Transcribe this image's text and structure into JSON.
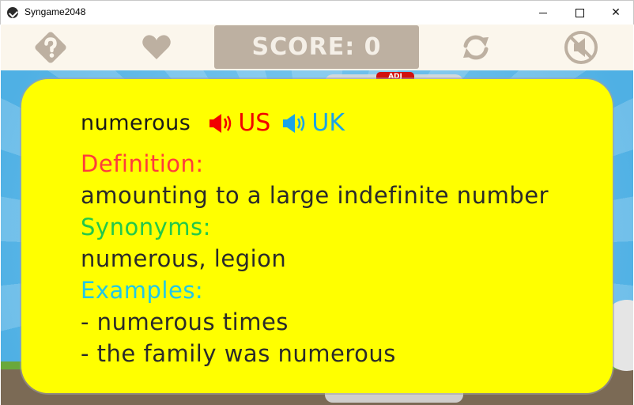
{
  "window": {
    "title": "Syngame2048",
    "close_glyph": "✕"
  },
  "toolbar": {
    "help_icon": "question-diamond-icon",
    "favorite_icon": "heart-icon",
    "score_label": "SCORE: 0",
    "refresh_icon": "refresh-icon",
    "mute_icon": "mute-icon",
    "icon_color": "#bdb0a1"
  },
  "game": {
    "tile_tag": "ADJ"
  },
  "card": {
    "background": "#ffff00",
    "word": "numerous",
    "pron_us": "US",
    "pron_uk": "UK",
    "definition_label": "Definition:",
    "definition": "amounting to a large indefinite number",
    "synonyms_label": "Synonyms:",
    "synonyms": "numerous, legion",
    "examples_label": "Examples:",
    "examples": [
      "- numerous times",
      "- the family was numerous"
    ],
    "colors": {
      "definition_label": "#ff3b3b",
      "synonyms_label": "#22c84a",
      "examples_label": "#22c8e6",
      "us": "#f20000",
      "uk": "#1aa3e8"
    }
  }
}
